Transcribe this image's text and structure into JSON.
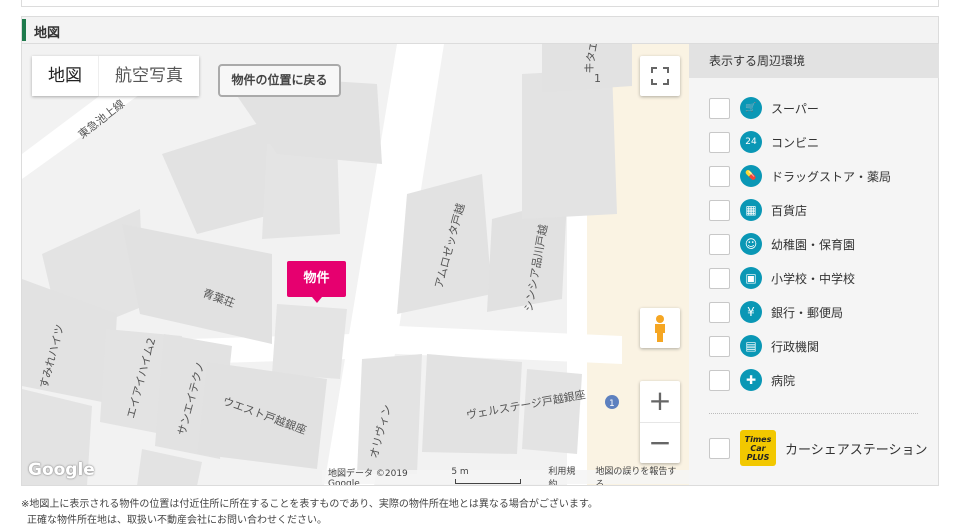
{
  "section": {
    "title": "地図"
  },
  "map": {
    "tabs": [
      {
        "label": "地図",
        "active": true
      },
      {
        "label": "航空写真",
        "active": false
      }
    ],
    "back_button": "物件の位置に戻る",
    "marker_label": "物件",
    "google_logo": "Google",
    "attribution": {
      "data": "地図データ ©2019 Google",
      "scale": "5 m",
      "terms": "利用規約",
      "report": "地図の誤りを報告する"
    },
    "place_labels": {
      "green_leaf": "青葉荘",
      "sumire": "すみれハイツ",
      "aihaim": "エイアイハイム2",
      "sunei": "サンエイテクノ",
      "west": "ウエスト戸越銀座",
      "amuro": "アムロゼッタ戸越",
      "sinsia": "シンシア品川戸越",
      "olivin": "オリヴィン",
      "velstage": "ヴェルステージ戸越銀座",
      "tokyu": "東急池上線",
      "kita": "キタエ",
      "block1": "1",
      "block_olivin": "1",
      "route_badge": "1"
    },
    "controls": {
      "fullscreen_icon": "fullscreen-icon",
      "pegman_icon": "pegman-icon",
      "zoom_in": "+",
      "zoom_out": "−"
    }
  },
  "sidebar": {
    "header": "表示する周辺環境",
    "items": [
      {
        "label": "スーパー",
        "icon": "cart-icon",
        "glyph": "🛒"
      },
      {
        "label": "コンビニ",
        "icon": "convenience-store-icon",
        "glyph": "24"
      },
      {
        "label": "ドラッグストア・薬局",
        "icon": "pill-icon",
        "glyph": "💊"
      },
      {
        "label": "百貨店",
        "icon": "department-store-icon",
        "glyph": "▦"
      },
      {
        "label": "幼稚園・保育園",
        "icon": "kindergarten-icon",
        "glyph": "☺"
      },
      {
        "label": "小学校・中学校",
        "icon": "school-bag-icon",
        "glyph": "▣"
      },
      {
        "label": "銀行・郵便局",
        "icon": "bank-icon",
        "glyph": "¥"
      },
      {
        "label": "行政機関",
        "icon": "government-icon",
        "glyph": "▤"
      },
      {
        "label": "病院",
        "icon": "hospital-icon",
        "glyph": "✚"
      }
    ],
    "carshare": {
      "label": "カーシェアステーション",
      "logo_line1": "Times",
      "logo_line2": "Car",
      "logo_line3": "PLUS"
    }
  },
  "notes": {
    "line1": "※地図上に表示される物件の位置は付近住所に所在することを表すものであり、実際の物件所在地とは異なる場合がございます。",
    "line2": "正確な物件所在地は、取扱い不動産会社にお問い合わせください。"
  },
  "colors": {
    "accent_green": "#1e7a4c",
    "marker": "#e6006f",
    "poi_teal": "#0a97b5",
    "times_yellow": "#f2c800"
  }
}
